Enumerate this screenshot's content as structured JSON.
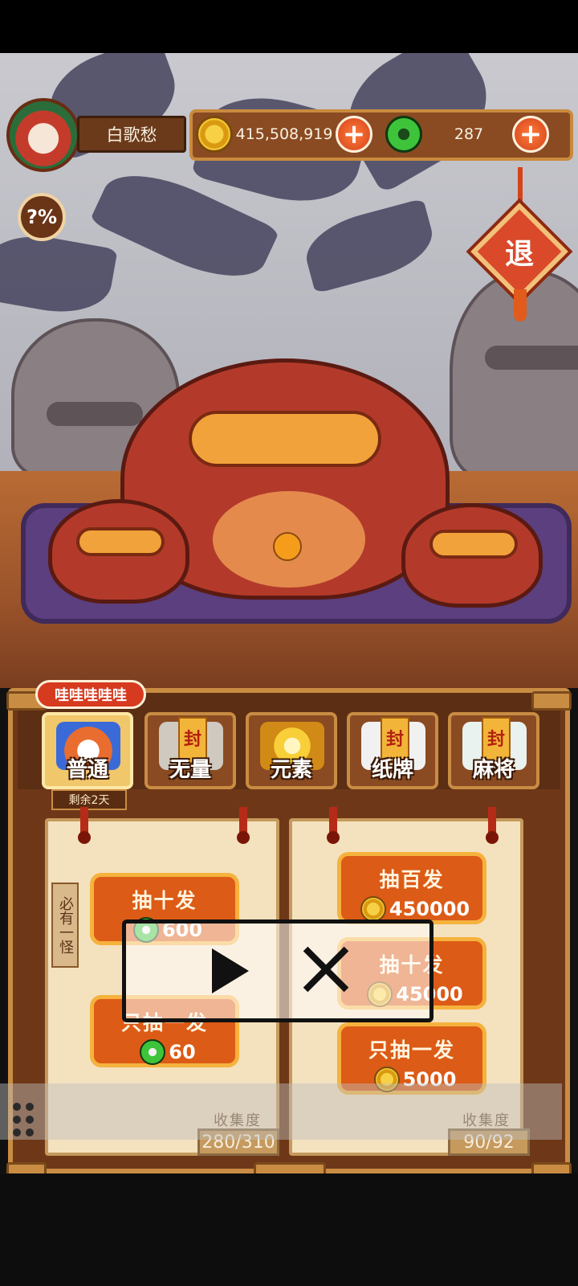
{
  "header": {
    "player_name": "白歌愁",
    "gold": "415,508,919",
    "jade": "287"
  },
  "buttons": {
    "help": "?%",
    "exit": "退",
    "add": "+"
  },
  "tabs": {
    "promo": "哇哇哇哇哇",
    "remaining": "剩余2天",
    "items": [
      {
        "label": "普通",
        "seal": ""
      },
      {
        "label": "无量",
        "seal": "封"
      },
      {
        "label": "元素",
        "seal": ""
      },
      {
        "label": "纸牌",
        "seal": "封"
      },
      {
        "label": "麻将",
        "seal": "封"
      }
    ]
  },
  "left_pool": {
    "tag": "必有一怪",
    "ten_draw": {
      "label": "抽十发",
      "cost": "600",
      "currency": "jade"
    },
    "one_draw": {
      "label": "只抽一发",
      "cost": "60",
      "currency": "jade"
    },
    "collect_label": "收集度",
    "collect_value": "280/310"
  },
  "right_pool": {
    "hundred_draw": {
      "label": "抽百发",
      "cost": "450000",
      "currency": "gold"
    },
    "ten_draw": {
      "label": "抽十发",
      "cost": "45000",
      "currency": "gold"
    },
    "one_draw": {
      "label": "只抽一发",
      "cost": "5000",
      "currency": "gold"
    },
    "collect_label": "收集度",
    "collect_value": "90/92"
  },
  "icons": [
    "avatar-icon",
    "gold-coin-icon",
    "jade-icon",
    "plus-icon",
    "play-icon",
    "close-icon",
    "menu-dots-icon"
  ]
}
